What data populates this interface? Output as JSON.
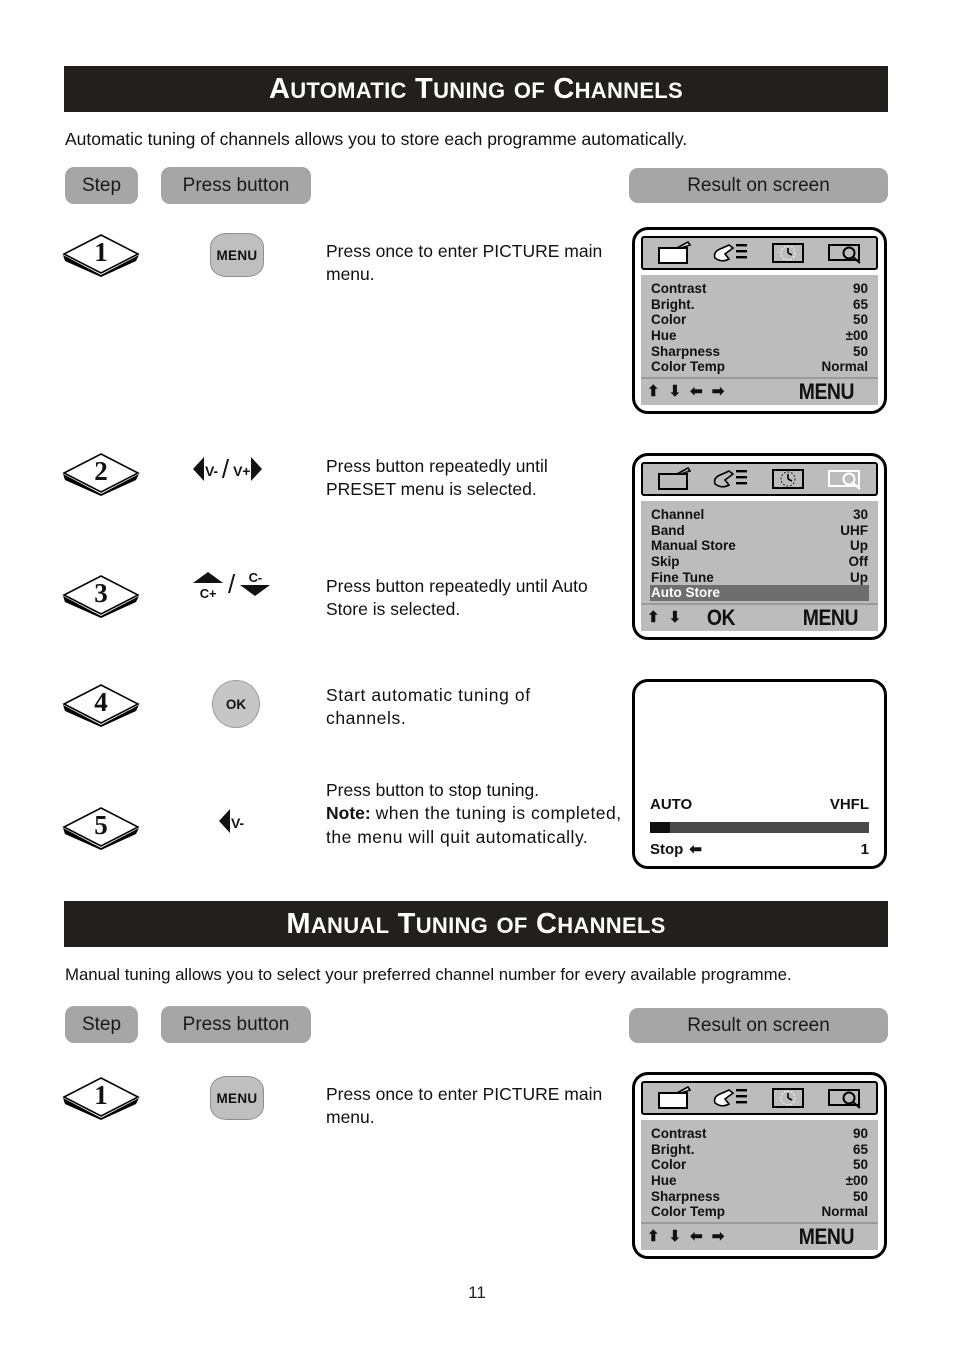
{
  "page": {
    "number": "11"
  },
  "sections": [
    {
      "id": "automatic",
      "title_parts": [
        {
          "big": "A",
          "small": "UTOMATIC"
        },
        {
          "big": "T",
          "small": "UNING"
        },
        {
          "big": "",
          "small": "OF"
        },
        {
          "big": "C",
          "small": "HANNELS"
        }
      ],
      "title_plain": "Automatic Tuning of Channels",
      "intro": "Automatic tuning of channels allows you to store each programme automatically.",
      "col_step_label": "Step",
      "col_button_label": "Press  button",
      "col_result_label": "Result  on  screen",
      "steps": [
        {
          "number": "1",
          "button_kind": "menu",
          "button_label": "MENU",
          "instruction": "Press once to enter PICTURE main menu."
        },
        {
          "number": "2",
          "button_kind": "vminus-vplus",
          "button_label_left": "V-",
          "button_label_right": "V+",
          "instruction": "Press button repeatedly until PRESET menu is selected."
        },
        {
          "number": "3",
          "button_kind": "cplus-cminus",
          "button_label_up": "C+",
          "button_label_down": "C-",
          "instruction": "Press button repeatedly until Auto Store is selected."
        },
        {
          "number": "4",
          "button_kind": "ok",
          "button_label": "OK",
          "instruction": "Start automatic tuning of channels."
        },
        {
          "number": "5",
          "button_kind": "vminus",
          "button_label": "V-",
          "instruction_line1": "Press button to stop tuning.",
          "instruction_note_label": "Note:",
          "instruction_note_rest": "when the tuning is completed, the menu will quit automatically."
        }
      ]
    },
    {
      "id": "manual",
      "title_parts": [
        {
          "big": "M",
          "small": "ANUAL"
        },
        {
          "big": "T",
          "small": "UNING"
        },
        {
          "big": "",
          "small": "OF"
        },
        {
          "big": "C",
          "small": "HANNELS"
        }
      ],
      "title_plain": "Manual Tuning of Channels",
      "intro": "Manual tuning allows you to select your preferred channel number for every available programme.",
      "col_step_label": "Step",
      "col_button_label": "Press  button",
      "col_result_label": "Result  on  screen",
      "steps": [
        {
          "number": "1",
          "button_kind": "menu",
          "button_label": "MENU",
          "instruction": "Press once to enter PICTURE main menu."
        }
      ]
    }
  ],
  "osd": {
    "icons": [
      "tv-icon",
      "hand-sound-icon",
      "clock-timer-icon",
      "magnifier-preset-icon"
    ],
    "picture_menu": {
      "active_icon_index": 0,
      "rows": [
        {
          "label": "Contrast",
          "value": "90"
        },
        {
          "label": "Bright.",
          "value": "65"
        },
        {
          "label": "Color",
          "value": "50"
        },
        {
          "label": "Hue",
          "value": "±00"
        },
        {
          "label": "Sharpness",
          "value": "50"
        },
        {
          "label": "Color Temp",
          "value": "Normal"
        }
      ],
      "footer_arrows": [
        "⬆",
        "⬇",
        "⬅",
        "➡"
      ],
      "footer_word": "MENU"
    },
    "preset_menu": {
      "active_icon_index": 3,
      "rows": [
        {
          "label": "Channel",
          "value": "30",
          "highlighted": false
        },
        {
          "label": "Band",
          "value": "UHF",
          "highlighted": false
        },
        {
          "label": "Manual Store",
          "value": "Up",
          "highlighted": false
        },
        {
          "label": "Skip",
          "value": "Off",
          "highlighted": false
        },
        {
          "label": "Fine Tune",
          "value": "Up",
          "highlighted": false
        },
        {
          "label": "Auto Store",
          "value": "",
          "highlighted": true
        }
      ],
      "footer_arrows": [
        "⬆",
        "⬇"
      ],
      "footer_ok": "OK",
      "footer_word": "MENU"
    },
    "auto_tuning_screen": {
      "label_left": "AUTO",
      "label_right": "VHFL",
      "progress_percent": 9,
      "stop_label": "Stop",
      "stop_arrow": "⬅",
      "channel_number": "1"
    }
  }
}
